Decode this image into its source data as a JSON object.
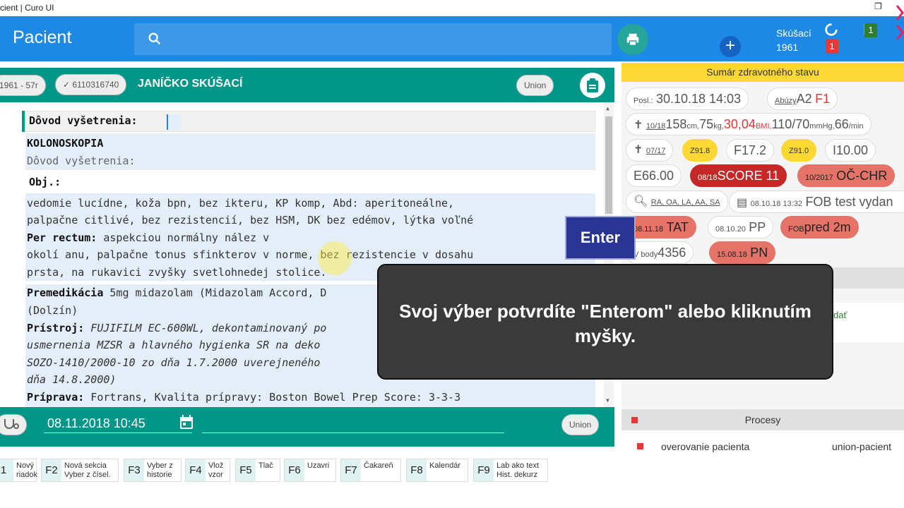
{
  "window": {
    "title": "cient | Curo UI",
    "restore_glyph": "❐"
  },
  "appbar": {
    "title": "Pacient",
    "search_placeholder": "",
    "add_glyph": "+"
  },
  "user": {
    "name": "Skúšací",
    "year": "1961",
    "notif_count": "1",
    "msg_count": "1"
  },
  "patient": {
    "chip_birth": "1961 - 57r",
    "chip_id": "6110316740",
    "chip_id_check": "✓",
    "name": "JANÍČKO SKÚŠACÍ",
    "insurer": "Union"
  },
  "editor": {
    "field_label": "Dôvod vyšetrenia:",
    "exam_type": "KOLONOSKOPIA",
    "reason_label": "Dôvod vyšetrenia:",
    "obj_label": "Obj.:",
    "obj_line1": "vedomie lucídne, koža bpn, bez ikteru, KP komp, Abd:  aperitoneálne,",
    "obj_line2": "palpačne citlivé, bez rezistencií, bez HSM, DK bez edémov, lýtka voľné",
    "rectum_label": "Per rectum:",
    "rectum_text": " aspekciou normálny nález v",
    "rectum_line2": "okolí anu, palpačne tonus sfinkterov v norme, bez rezistencie v dosahu",
    "rectum_line3": "prsta, na rukavici zvyšky svetlohnedej stolice.",
    "premed_label": "Premedikácia",
    "premed_text": " 5mg midazolam (Midazolam Accord, D",
    "premed_line2": "(Dolzín)",
    "device_label": "Prístroj:",
    "device_text": " FUJIFILM EC-600WL, dekontaminovaný po",
    "device_line2": "usmernenia MZSR a hlavného hygienka SR na deko",
    "device_line3": "SOZO-1410/2000-10 zo dňa 1.7.2000 uverejneného",
    "device_line4": "dňa 14.8.2000)",
    "prep_label": "Príprava:",
    "prep_text": " Fortrans, Kvalita prípravy: Boston Bowel Prep Score: 3-3-3"
  },
  "footer": {
    "datetime": "08.11.2018 10:45",
    "insurer": "Union"
  },
  "fkeys": [
    {
      "key": "1",
      "label": "Nový\nriadok"
    },
    {
      "key": "F2",
      "label": "Nová sekcia\nVyber z čísel."
    },
    {
      "key": "F3",
      "label": "Vyber z\nhistorie"
    },
    {
      "key": "F4",
      "label": "Vlož\nvzor"
    },
    {
      "key": "F5",
      "label": "Tlač"
    },
    {
      "key": "F6",
      "label": "Uzavri"
    },
    {
      "key": "F7",
      "label": "Čakareň"
    },
    {
      "key": "F8",
      "label": "Kalendár"
    },
    {
      "key": "F9",
      "label": "Lab ako text\nHist. dekurz"
    }
  ],
  "summary": {
    "title": "Sumár zdravotného stavu",
    "posl_label": "Posl.:",
    "posl_value": "30.10.18 14:03",
    "abuzy_label": "Abúzy",
    "abuzy_a": "A2",
    "abuzy_f": "F1",
    "vitals_date": "10/18",
    "vitals_height": "158",
    "vitals_height_unit": "cm,",
    "vitals_weight": "75",
    "vitals_weight_unit": "kg,",
    "vitals_bmi": "30,04",
    "vitals_bmi_unit": "BMI,",
    "vitals_bp": "110/70",
    "vitals_bp_unit": "mmHg,",
    "vitals_pulse": "66",
    "vitals_pulse_unit": "/min",
    "diag_date": "07/17",
    "diag1": "Z91.8",
    "diag2": "F17.2",
    "diag3": "Z91.0",
    "diag4": "I10.00",
    "diag5": "E66.00",
    "score_date": "08/18",
    "score": "SCORE 11",
    "oc_date": "10/2017",
    "oc": "OČ-CHR",
    "search_tags": "RA, OA, LA, AA, SA",
    "fob_date": "08.10.18 13:32",
    "fob": "FOB test vydan",
    "tat_date": "08.11.18",
    "tat": "TAT",
    "pp_date": "08.10.20",
    "pp": "PP",
    "fob2_label": "FOB",
    "fob2": "pred 2m",
    "vbody_label": "V body",
    "vbody": "4356",
    "pn_date": "15.08.18",
    "pn": "PN",
    "hidden_link": "dať"
  },
  "procesy": {
    "title": "Procesy",
    "item_name": "overovanie pacienta",
    "item_type": "union-pacient"
  },
  "overlay": {
    "enter_key": "Enter",
    "tooltip": "Svoj výber potvrdíte \"Enterom\" alebo kliknutím myšky."
  }
}
